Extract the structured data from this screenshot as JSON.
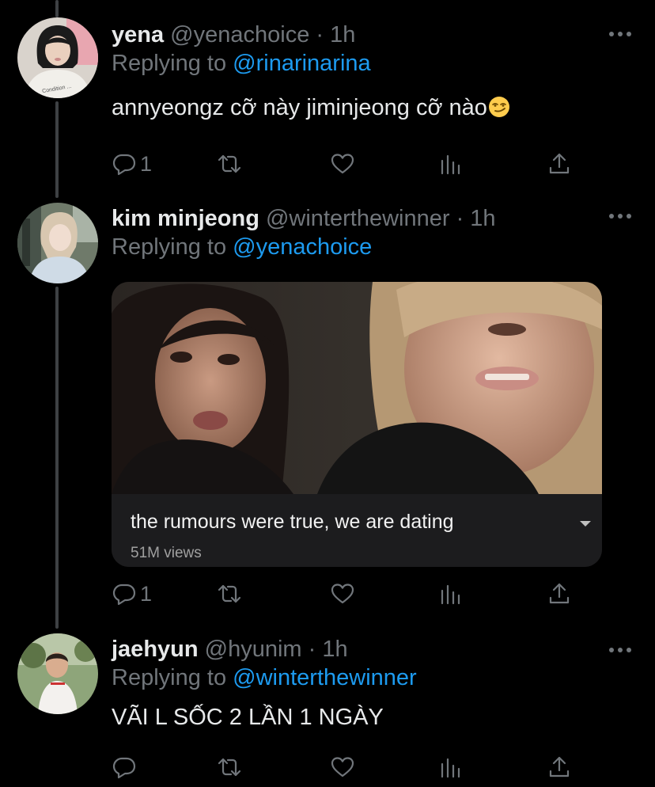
{
  "tweets": [
    {
      "name": "yena",
      "handle": "@yenachoice",
      "time": "· 1h",
      "replying_prefix": "Replying to ",
      "replying_to": "@rinarinarina",
      "text": "annyeongz cỡ này jiminjeong cỡ nào",
      "emoji": "smirking-face",
      "reply_count": "1"
    },
    {
      "name": "kim minjeong",
      "handle": "@winterthewinner",
      "time": "· 1h",
      "replying_prefix": "Replying to ",
      "replying_to": "@yenachoice",
      "media": {
        "caption": "the rumours were true, we are dating",
        "views": "51M views"
      },
      "reply_count": "1"
    },
    {
      "name": "jaehyun",
      "handle": "@hyunim",
      "time": "· 1h",
      "replying_prefix": "Replying to ",
      "replying_to": "@winterthewinner",
      "text": "VÃI L SỐC 2 LẦN 1 NGÀY",
      "reply_count": ""
    }
  ],
  "icons": {
    "reply": "reply-icon",
    "retweet": "retweet-icon",
    "like": "like-icon",
    "analytics": "analytics-icon",
    "share": "share-icon",
    "more": "more-icon"
  },
  "colors": {
    "background": "#000000",
    "primary_text": "#e7e9ea",
    "secondary_text": "#71767b",
    "accent": "#1d9bf0",
    "thread_line": "#3e4144"
  }
}
